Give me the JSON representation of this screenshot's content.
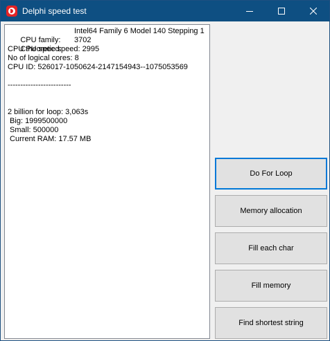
{
  "window": {
    "title": "Delphi speed test",
    "icon": "delphi-app-icon"
  },
  "title_buttons": {
    "minimize_icon": "minimize-icon",
    "maximize_icon": "maximize-icon",
    "close_icon": "close-icon"
  },
  "log": {
    "cpu_family_label": "CPU family:",
    "cpu_family_value": "Intel64 Family 6 Model 140 Stepping 1",
    "cpu_speed_label": "CPU speed:",
    "cpu_speed_value": "3702",
    "cpu_theoretic_speed": "CPU theoretic speed: 2995",
    "logical_cores": "No of logical cores: 8",
    "cpu_id": "CPU ID: 526017-1050624-2147154943--1075053569",
    "separator": "-------------------------",
    "loop_result": "2 billion for loop: 3,063s",
    "big": " Big: 1999500000",
    "small": " Small: 500000",
    "current_ram": " Current RAM: 17.57 MB"
  },
  "buttons": {
    "do_for_loop": "Do For Loop",
    "memory_allocation": "Memory allocation",
    "fill_each_char": "Fill each char",
    "fill_memory": "Fill memory",
    "find_shortest_string": "Find shortest string"
  },
  "colors": {
    "titlebar": "#0e4f82",
    "focus_border": "#0078d7",
    "button_face": "#e1e1e1",
    "window_face": "#f0f0f0"
  }
}
